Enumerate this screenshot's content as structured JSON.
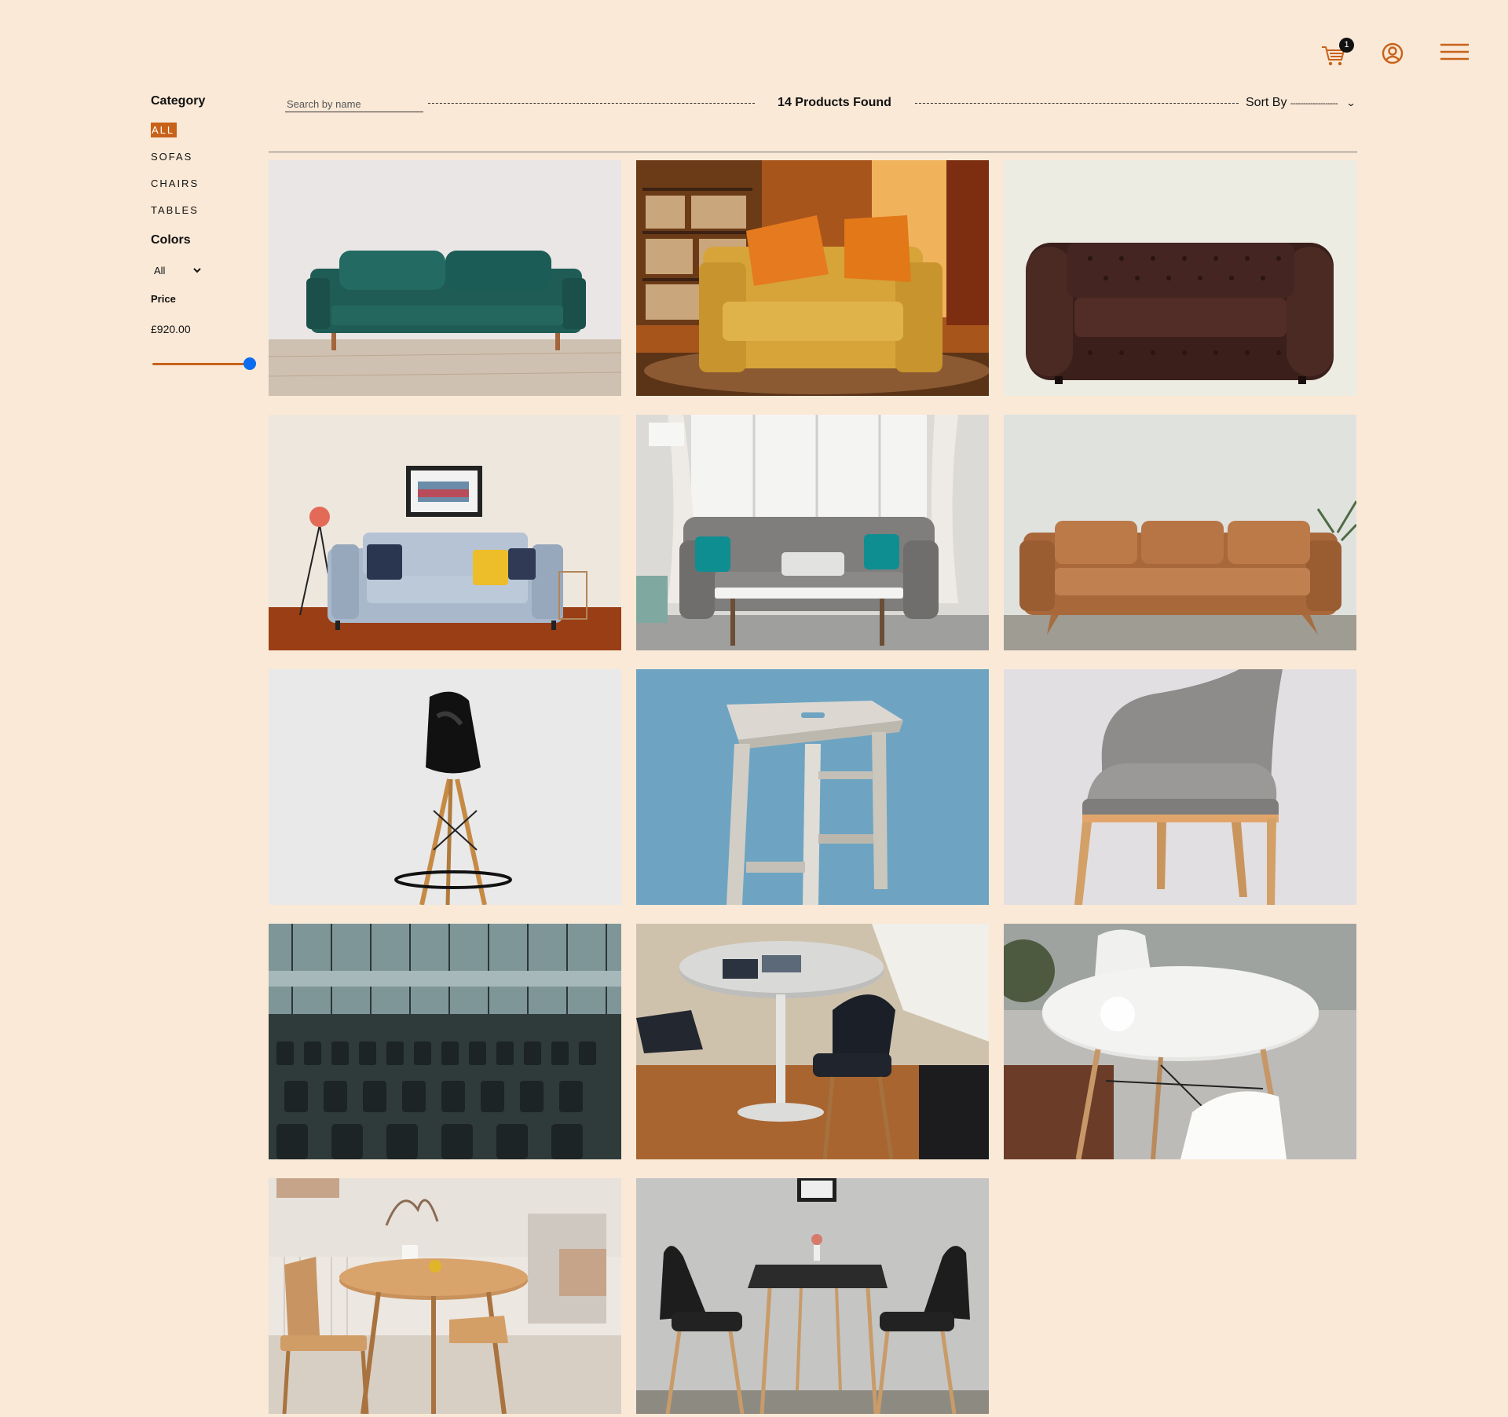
{
  "header": {
    "cart_count": "1"
  },
  "sidebar": {
    "category_heading": "Category",
    "categories": [
      {
        "label": "ALL",
        "active": true
      },
      {
        "label": "SOFAS",
        "active": false
      },
      {
        "label": "CHAIRS",
        "active": false
      },
      {
        "label": "TABLES",
        "active": false
      }
    ],
    "colors_heading": "Colors",
    "color_selected": "All",
    "price_heading": "Price",
    "price_value": "£920.00",
    "price_slider_fraction": 1.0
  },
  "toolbar": {
    "search_placeholder": "Search by name",
    "products_found": "14 Products Found",
    "sort_label": "Sort By",
    "sort_selected": "-------------------"
  },
  "colors": {
    "background": "#fae9d7",
    "accent": "#c8621a",
    "slider_thumb": "#0b6cf0"
  },
  "products": [
    {
      "name": "green-velvet-sofa",
      "category": "sofa"
    },
    {
      "name": "yellow-loveseat",
      "category": "sofa"
    },
    {
      "name": "brown-chesterfield-sofa",
      "category": "sofa"
    },
    {
      "name": "blue-grey-sofa",
      "category": "sofa"
    },
    {
      "name": "grey-tufted-sofa",
      "category": "sofa"
    },
    {
      "name": "tan-leather-sofa",
      "category": "sofa"
    },
    {
      "name": "black-bar-stool",
      "category": "chair"
    },
    {
      "name": "wooden-stool",
      "category": "chair"
    },
    {
      "name": "grey-armchair",
      "category": "chair"
    },
    {
      "name": "conference-chairs",
      "category": "chair"
    },
    {
      "name": "round-table-with-chairs",
      "category": "table"
    },
    {
      "name": "white-round-table",
      "category": "table"
    },
    {
      "name": "wooden-dining-set",
      "category": "table"
    },
    {
      "name": "black-bistro-set",
      "category": "table"
    }
  ]
}
